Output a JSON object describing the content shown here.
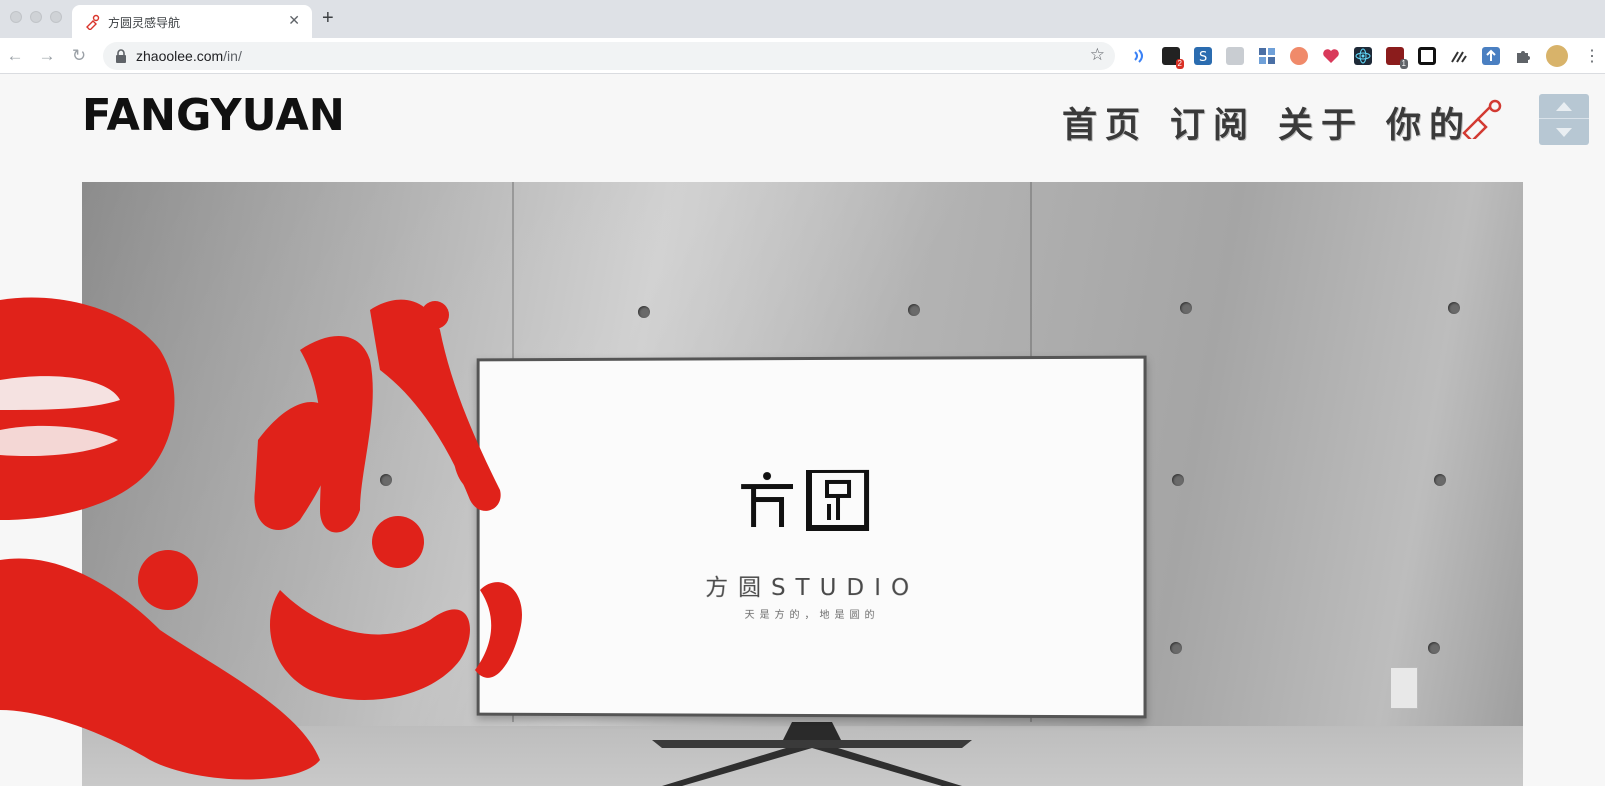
{
  "browser": {
    "tab": {
      "title": "方圆灵感导航"
    },
    "new_tab_label": "+",
    "close_label": "✕",
    "address": {
      "domain": "zhaoolee.com",
      "path": "/in/"
    },
    "nav": {
      "back": "←",
      "forward": "→",
      "reload": "↻"
    },
    "bookmark_star": "☆",
    "extensions": [
      {
        "icon": "voice-icon",
        "badge": ""
      },
      {
        "icon": "mail-icon",
        "badge": "2"
      },
      {
        "icon": "s-icon",
        "badge": ""
      },
      {
        "icon": "image-icon",
        "badge": ""
      },
      {
        "icon": "grid-icon",
        "badge": ""
      },
      {
        "icon": "tomato-icon",
        "badge": ""
      },
      {
        "icon": "heart-icon",
        "badge": ""
      },
      {
        "icon": "react-icon",
        "badge": ""
      },
      {
        "icon": "shield-icon",
        "badge": "1"
      },
      {
        "icon": "qr-icon",
        "badge": ""
      },
      {
        "icon": "pen-icon",
        "badge": ""
      },
      {
        "icon": "upload-icon",
        "badge": ""
      },
      {
        "icon": "puzzle-icon",
        "badge": ""
      },
      {
        "icon": "avatar-icon",
        "badge": ""
      }
    ]
  },
  "site": {
    "logo": "FANGYUAN",
    "nav": [
      {
        "label": "首页"
      },
      {
        "label": "订阅"
      },
      {
        "label": "关于"
      },
      {
        "label": "你的"
      }
    ],
    "hero": {
      "brand": "方圆STUDIO",
      "slogan": "天是方的，地是圆的",
      "brush_text": "灵感"
    }
  },
  "colors": {
    "brush_red": "#e0221a",
    "scroll_widget": "#b7c7d3",
    "logo": "#111111"
  }
}
